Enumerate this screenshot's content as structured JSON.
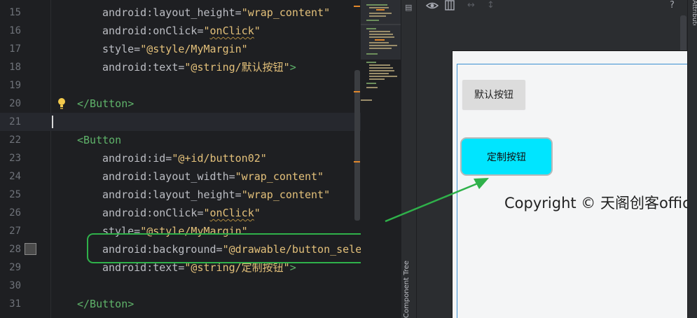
{
  "editor": {
    "lines": [
      {
        "num": "15",
        "indent": 2,
        "parts": [
          {
            "t": "android:layout_height=",
            "c": "attr"
          },
          {
            "t": "\"wrap_content\"",
            "c": "val"
          }
        ]
      },
      {
        "num": "16",
        "indent": 2,
        "parts": [
          {
            "t": "android:onClick=",
            "c": "attr"
          },
          {
            "t": "\"",
            "c": "val"
          },
          {
            "t": "onClick",
            "c": "val-u"
          },
          {
            "t": "\"",
            "c": "val"
          }
        ]
      },
      {
        "num": "17",
        "indent": 2,
        "parts": [
          {
            "t": "style=",
            "c": "attr"
          },
          {
            "t": "\"@style/MyMargin\"",
            "c": "val"
          }
        ]
      },
      {
        "num": "18",
        "indent": 2,
        "parts": [
          {
            "t": "android:text=",
            "c": "attr"
          },
          {
            "t": "\"@string/默认按钮\"",
            "c": "val"
          },
          {
            "t": ">",
            "c": "tag"
          }
        ]
      },
      {
        "num": "19",
        "indent": 0,
        "parts": []
      },
      {
        "num": "20",
        "indent": 1,
        "parts": [
          {
            "t": "</Button>",
            "c": "tag"
          }
        ]
      },
      {
        "num": "21",
        "indent": 0,
        "parts": [],
        "current": true
      },
      {
        "num": "22",
        "indent": 1,
        "parts": [
          {
            "t": "<Button",
            "c": "tag"
          }
        ]
      },
      {
        "num": "23",
        "indent": 2,
        "parts": [
          {
            "t": "android:id=",
            "c": "attr"
          },
          {
            "t": "\"@+id/button02\"",
            "c": "val"
          }
        ]
      },
      {
        "num": "24",
        "indent": 2,
        "parts": [
          {
            "t": "android:layout_width=",
            "c": "attr"
          },
          {
            "t": "\"wrap_content\"",
            "c": "val"
          }
        ]
      },
      {
        "num": "25",
        "indent": 2,
        "parts": [
          {
            "t": "android:layout_height=",
            "c": "attr"
          },
          {
            "t": "\"wrap_content\"",
            "c": "val"
          }
        ]
      },
      {
        "num": "26",
        "indent": 2,
        "parts": [
          {
            "t": "android:onClick=",
            "c": "attr"
          },
          {
            "t": "\"",
            "c": "val"
          },
          {
            "t": "onClick",
            "c": "val-u"
          },
          {
            "t": "\"",
            "c": "val"
          }
        ]
      },
      {
        "num": "27",
        "indent": 2,
        "parts": [
          {
            "t": "style=",
            "c": "attr"
          },
          {
            "t": "\"@style/MyMargin\"",
            "c": "val"
          }
        ]
      },
      {
        "num": "28",
        "indent": 2,
        "parts": [
          {
            "t": "android:background=",
            "c": "attr"
          },
          {
            "t": "\"@drawable/button_sele",
            "c": "val"
          }
        ]
      },
      {
        "num": "29",
        "indent": 2,
        "parts": [
          {
            "t": "android:text=",
            "c": "attr"
          },
          {
            "t": "\"@string/定制按钮\"",
            "c": "val"
          },
          {
            "t": ">",
            "c": "tag"
          }
        ]
      },
      {
        "num": "30",
        "indent": 0,
        "parts": []
      },
      {
        "num": "31",
        "indent": 1,
        "parts": [
          {
            "t": "</Button>",
            "c": "tag"
          }
        ]
      }
    ]
  },
  "side_panel": {
    "component_tree_label": "Component Tree",
    "attributes_label": "Attributes"
  },
  "toolbar": {
    "eye_icon": "eye-icon",
    "layout_icon": "layout-icon",
    "help": "?"
  },
  "preview": {
    "default_button_label": "默认按钮",
    "custom_button_label": "定制按钮",
    "copyright_text": "Copyright © 天阁创客official"
  },
  "colors": {
    "highlight_green": "#2fb14a",
    "custom_button_bg": "#00e5ff",
    "tag": "#5fb36a",
    "value": "#e3c07a"
  }
}
